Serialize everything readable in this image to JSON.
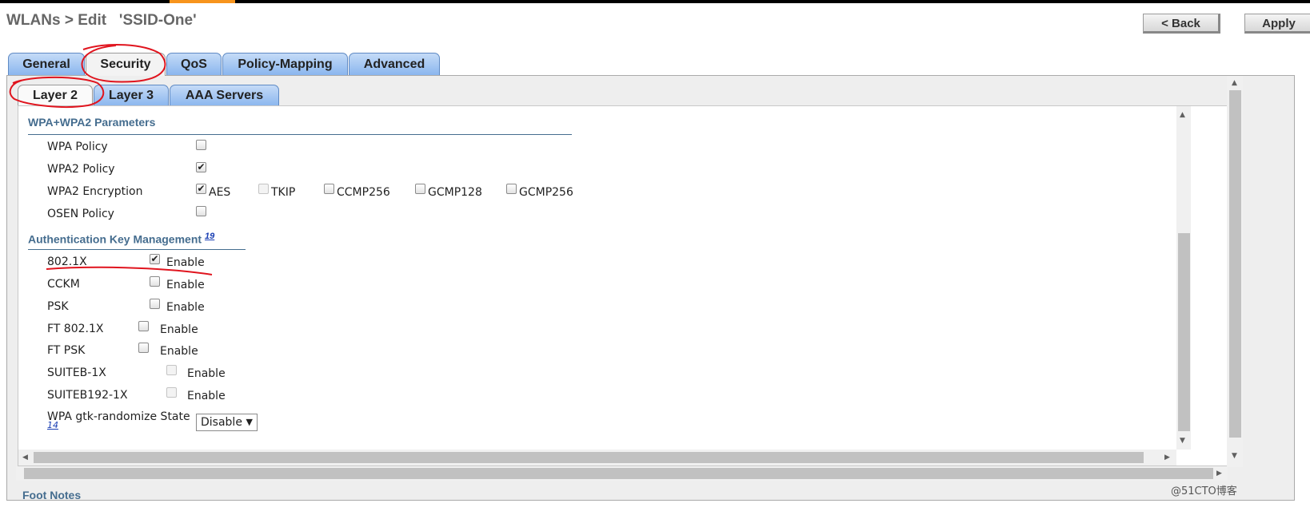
{
  "header": {
    "title": "WLANs > Edit   'SSID-One'",
    "back_label": "< Back",
    "apply_label": "Apply"
  },
  "main_tabs": [
    {
      "label": "General",
      "active": false
    },
    {
      "label": "Security",
      "active": true
    },
    {
      "label": "QoS",
      "active": false
    },
    {
      "label": "Policy-Mapping",
      "active": false
    },
    {
      "label": "Advanced",
      "active": false
    }
  ],
  "sub_tabs": [
    {
      "label": "Layer 2",
      "active": true
    },
    {
      "label": "Layer 3",
      "active": false
    },
    {
      "label": "AAA Servers",
      "active": false
    }
  ],
  "wpa": {
    "heading": "WPA+WPA2 Parameters",
    "rows": [
      {
        "label": "WPA Policy",
        "checked": false
      },
      {
        "label": "WPA2 Policy",
        "checked": true
      },
      {
        "label": "WPA2 Encryption"
      },
      {
        "label": "OSEN Policy",
        "checked": false
      }
    ],
    "encryption_options": [
      {
        "label": "AES",
        "checked": true,
        "disabled": false
      },
      {
        "label": "TKIP",
        "checked": false,
        "disabled": true
      },
      {
        "label": "CCMP256",
        "checked": false,
        "disabled": false
      },
      {
        "label": "GCMP128",
        "checked": false,
        "disabled": false
      },
      {
        "label": "GCMP256",
        "checked": false,
        "disabled": false
      }
    ]
  },
  "akm": {
    "heading": "Authentication Key Management",
    "footnote_ref": "19",
    "enable_label": "Enable",
    "rows": [
      {
        "label": "802.1X",
        "checked": true,
        "disabled": false
      },
      {
        "label": "CCKM",
        "checked": false,
        "disabled": false
      },
      {
        "label": "PSK",
        "checked": false,
        "disabled": false
      },
      {
        "label": "FT 802.1X",
        "checked": false,
        "disabled": false
      },
      {
        "label": "FT PSK",
        "checked": false,
        "disabled": false
      },
      {
        "label": "SUITEB-1X",
        "checked": false,
        "disabled": true
      },
      {
        "label": "SUITEB192-1X",
        "checked": false,
        "disabled": true
      }
    ],
    "gtk": {
      "label": "WPA gtk-randomize State",
      "footnote_ref": "14",
      "value": "Disable"
    }
  },
  "footer": {
    "foot_notes": "Foot Notes",
    "watermark": "@51CTO博客"
  },
  "colors": {
    "tab_blue": "#8ab6ee",
    "heading_blue": "#456d8f",
    "annotation_red": "#e0141e",
    "accent_orange": "#f7941d"
  },
  "icons": {
    "check": "✔",
    "select_arrow": "▼",
    "scroll_up": "▲",
    "scroll_down": "▼",
    "scroll_left": "◀",
    "scroll_right": "▶"
  }
}
